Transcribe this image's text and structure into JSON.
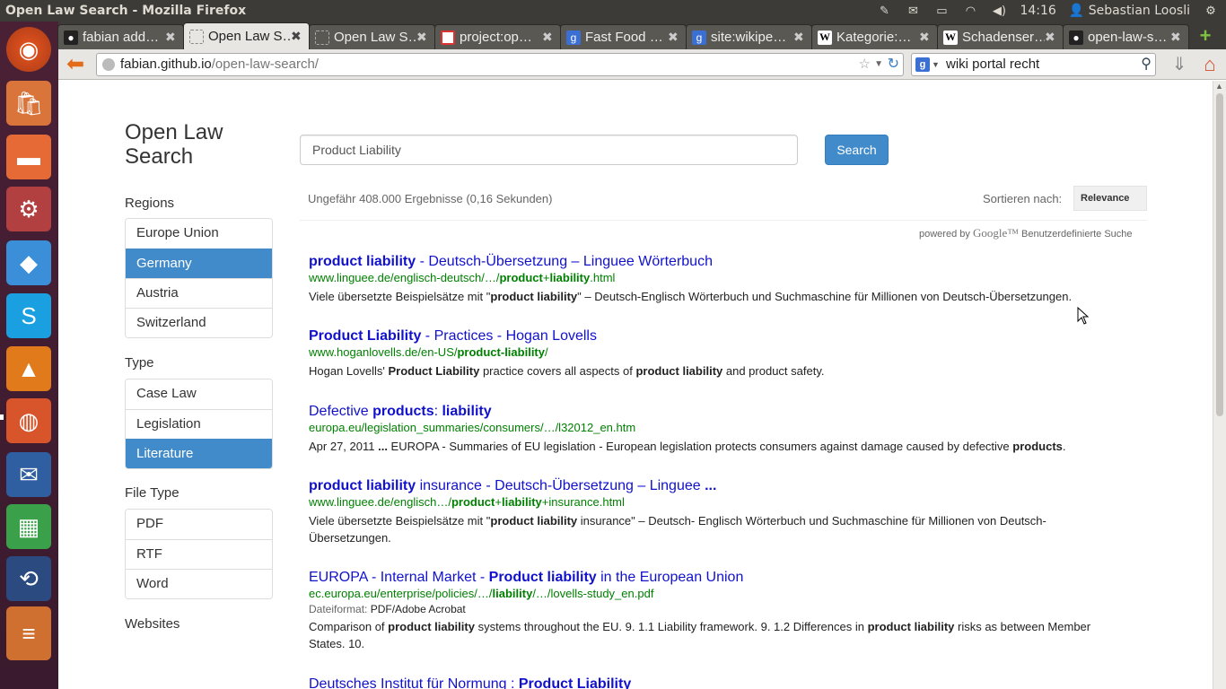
{
  "system": {
    "window_title": "Open Law Search - Mozilla Firefox",
    "clock": "14:16",
    "user": "Sebastian Loosli",
    "tray_icons": [
      "edit-icon",
      "mail-icon",
      "battery-icon",
      "wifi-icon",
      "volume-icon",
      "user-icon",
      "gear-icon"
    ]
  },
  "launcher": {
    "items": [
      "ubuntu-logo-icon",
      "software-center-icon",
      "files-icon",
      "system-settings-icon",
      "dropbox-icon",
      "skype-icon",
      "vlc-icon",
      "firefox-icon",
      "thunderbird-icon",
      "spreadsheet-icon",
      "sync-icon",
      "stacked-apps-icon"
    ]
  },
  "tabs": [
    {
      "label": "fabian add…",
      "icon": "github-icon"
    },
    {
      "label": "Open Law S…",
      "icon": "page-icon",
      "active": true
    },
    {
      "label": "Open Law S…",
      "icon": "page-icon"
    },
    {
      "label": "project:op…",
      "icon": "project-icon"
    },
    {
      "label": "Fast Food …",
      "icon": "google-icon"
    },
    {
      "label": "site:wikipe…",
      "icon": "google-icon"
    },
    {
      "label": "Kategorie:…",
      "icon": "wikipedia-icon"
    },
    {
      "label": "Schadenser…",
      "icon": "wikipedia-icon"
    },
    {
      "label": "open-law-s…",
      "icon": "github-icon"
    }
  ],
  "navbar": {
    "url_host": "fabian.github.io",
    "url_path": "/open-law-search/",
    "search_value": "wiki portal recht"
  },
  "page": {
    "brand": "Open Law Search",
    "search_value": "Product Liability",
    "search_button": "Search",
    "result_info": "Ungefähr 408.000 Ergebnisse (0,16 Sekunden)",
    "sort_label": "Sortieren nach:",
    "sort_value": "Relevance",
    "powered_prefix": "powered by",
    "powered_logo": "Google™",
    "powered_suffix": "Benutzerdefinierte Suche",
    "filters": {
      "regions": {
        "heading": "Regions",
        "items": [
          {
            "label": "Europe Union",
            "active": false
          },
          {
            "label": "Germany",
            "active": true
          },
          {
            "label": "Austria",
            "active": false
          },
          {
            "label": "Switzerland",
            "active": false
          }
        ]
      },
      "type": {
        "heading": "Type",
        "items": [
          {
            "label": "Case Law",
            "active": false
          },
          {
            "label": "Legislation",
            "active": false
          },
          {
            "label": "Literature",
            "active": true
          }
        ]
      },
      "file_type": {
        "heading": "File Type",
        "items": [
          {
            "label": "PDF",
            "active": false
          },
          {
            "label": "RTF",
            "active": false
          },
          {
            "label": "Word",
            "active": false
          }
        ]
      },
      "websites": {
        "heading": "Websites"
      }
    },
    "results": [
      {
        "title": [
          [
            "product liability",
            true
          ],
          [
            " - Deutsch-Übersetzung – Linguee Wörterbuch",
            false
          ]
        ],
        "url": [
          [
            "www.linguee.de/englisch-deutsch/…/",
            false
          ],
          [
            "product",
            true
          ],
          [
            "+",
            false
          ],
          [
            "liability",
            true
          ],
          [
            ".html",
            false
          ]
        ],
        "snippet": [
          [
            "Viele übersetzte Beispielsätze mit \"",
            false
          ],
          [
            "product liability",
            true
          ],
          [
            "\" – Deutsch-Englisch Wörterbuch und Suchmaschine für Millionen von Deutsch-Übersetzungen.",
            false
          ]
        ]
      },
      {
        "title": [
          [
            "Product Liability",
            true
          ],
          [
            " - Practices - Hogan Lovells",
            false
          ]
        ],
        "url": [
          [
            "www.hoganlovells.de/en-US/",
            false
          ],
          [
            "product-liability",
            true
          ],
          [
            "/",
            false
          ]
        ],
        "snippet": [
          [
            "Hogan Lovells' ",
            false
          ],
          [
            "Product Liability",
            true
          ],
          [
            " practice covers all aspects of ",
            false
          ],
          [
            "product liability",
            true
          ],
          [
            " and product safety.",
            false
          ]
        ]
      },
      {
        "title": [
          [
            "Defective ",
            false
          ],
          [
            "products",
            true
          ],
          [
            ": ",
            false
          ],
          [
            "liability",
            true
          ]
        ],
        "url": [
          [
            "europa.eu/legislation_summaries/consumers/…/l32012_en.htm",
            false
          ]
        ],
        "snippet": [
          [
            "Apr 27, 2011 ",
            false
          ],
          [
            "...",
            true
          ],
          [
            " EUROPA - Summaries of EU legislation - European legislation protects consumers against damage caused by defective ",
            false
          ],
          [
            "products",
            true
          ],
          [
            ".",
            false
          ]
        ]
      },
      {
        "title": [
          [
            "product liability",
            true
          ],
          [
            " insurance - Deutsch-Übersetzung – Linguee ",
            false
          ],
          [
            "...",
            true
          ]
        ],
        "url": [
          [
            "www.linguee.de/englisch…/",
            false
          ],
          [
            "product",
            true
          ],
          [
            "+",
            false
          ],
          [
            "liability",
            true
          ],
          [
            "+insurance.html",
            false
          ]
        ],
        "snippet": [
          [
            "Viele übersetzte Beispielsätze mit \"",
            false
          ],
          [
            "product liability",
            true
          ],
          [
            " insurance\" – Deutsch- Englisch Wörterbuch und Suchmaschine für Millionen von Deutsch-Übersetzungen.",
            false
          ]
        ]
      },
      {
        "title": [
          [
            "EUROPA - Internal Market - ",
            false
          ],
          [
            "Product liability",
            true
          ],
          [
            " in the European Union",
            false
          ]
        ],
        "url": [
          [
            "ec.europa.eu/enterprise/policies/…/",
            false
          ],
          [
            "liability",
            true
          ],
          [
            "/…/lovells-study_en.pdf",
            false
          ]
        ],
        "meta_label": "Dateiformat:",
        "meta_value": "PDF/Adobe Acrobat",
        "snippet": [
          [
            "Comparison of ",
            false
          ],
          [
            "product liability",
            true
          ],
          [
            " systems throughout the EU. 9. 1.1 Liability framework. 9. 1.2 Differences in ",
            false
          ],
          [
            "product liability",
            true
          ],
          [
            " risks as between Member States. 10.",
            false
          ]
        ]
      },
      {
        "title": [
          [
            "Deutsches Institut für Normung : ",
            false
          ],
          [
            "Product Liability",
            true
          ]
        ],
        "url": [],
        "snippet": []
      }
    ]
  },
  "colors": {
    "accent": "#428bca",
    "link": "#1111cc",
    "url_green": "#008000",
    "launcher_bg": "#3a1a2e",
    "topbar_bg": "#3c3b37"
  }
}
